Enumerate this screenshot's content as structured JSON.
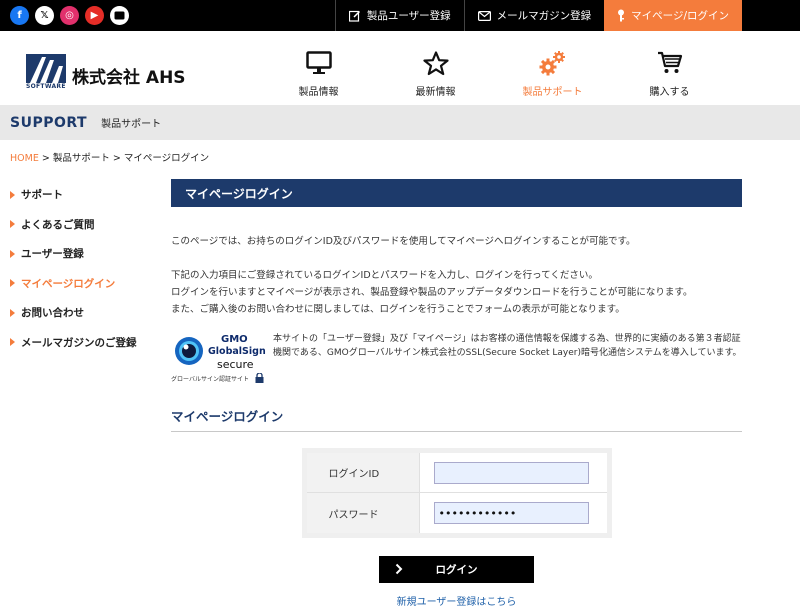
{
  "topbar": {
    "social": [
      {
        "name": "facebook-icon",
        "glyph": "f"
      },
      {
        "name": "x-icon",
        "glyph": "𝕏"
      },
      {
        "name": "instagram-icon",
        "glyph": "◎"
      },
      {
        "name": "youtube-icon",
        "glyph": "▶"
      },
      {
        "name": "tv-icon",
        "glyph": ""
      }
    ],
    "links": {
      "product_register": "製品ユーザー登録",
      "mail_magazine": "メールマガジン登録",
      "mypage_login": "マイページ/ログイン"
    }
  },
  "header": {
    "logo_text": "株式会社 AHS",
    "logo_sub": "SOFTWARE",
    "nav": {
      "products": "製品情報",
      "news": "最新情報",
      "support": "製品サポート",
      "buy": "購入する"
    }
  },
  "band": {
    "title": "SUPPORT",
    "subtitle": "製品サポート"
  },
  "breadcrumb": {
    "home": "HOME",
    "sep1": " > ",
    "support": "製品サポート",
    "sep2": " > ",
    "current": "マイページログイン"
  },
  "sidebar": {
    "items": [
      "サポート",
      "よくあるご質問",
      "ユーザー登録",
      "マイページログイン",
      "お問い合わせ",
      "メールマガジンのご登録"
    ]
  },
  "main": {
    "title": "マイページログイン",
    "intro": "このページでは、お持ちのログインID及びパスワードを使用してマイページへログインすることが可能です。",
    "lines": [
      "下記の入力項目にご登録されているログインIDとパスワードを入力し、ログインを行ってください。",
      "ログインを行いますとマイページが表示され、製品登録や製品のアップデータダウンロードを行うことが可能になります。",
      "また、ご購入後のお問い合わせに関しましては、ログインを行うことでフォームの表示が可能となります。"
    ],
    "ssl_badge": {
      "gmo": "GMO",
      "globalsign": "GlobalSign",
      "secure": "secure",
      "caption": "グローバルサイン認証サイト"
    },
    "ssl_text": "本サイトの「ユーザー登録」及び「マイページ」はお客様の通信情報を保護する為、世界的に実績のある第３者認証機関である、GMOグローバルサイン株式会社のSSL(Secure Socket Layer)暗号化通信システムを導入しています。",
    "form_heading": "マイページログイン",
    "form": {
      "login_id_label": "ログインID",
      "login_id_value": "",
      "password_label": "パスワード",
      "password_value": "••••••••••••"
    },
    "login_button": "ログイン",
    "register_link": "新規ユーザー登録はこちら"
  },
  "colors": {
    "accent": "#f47c3c",
    "navy": "#1d3a6b",
    "link": "#1d5fa8"
  }
}
